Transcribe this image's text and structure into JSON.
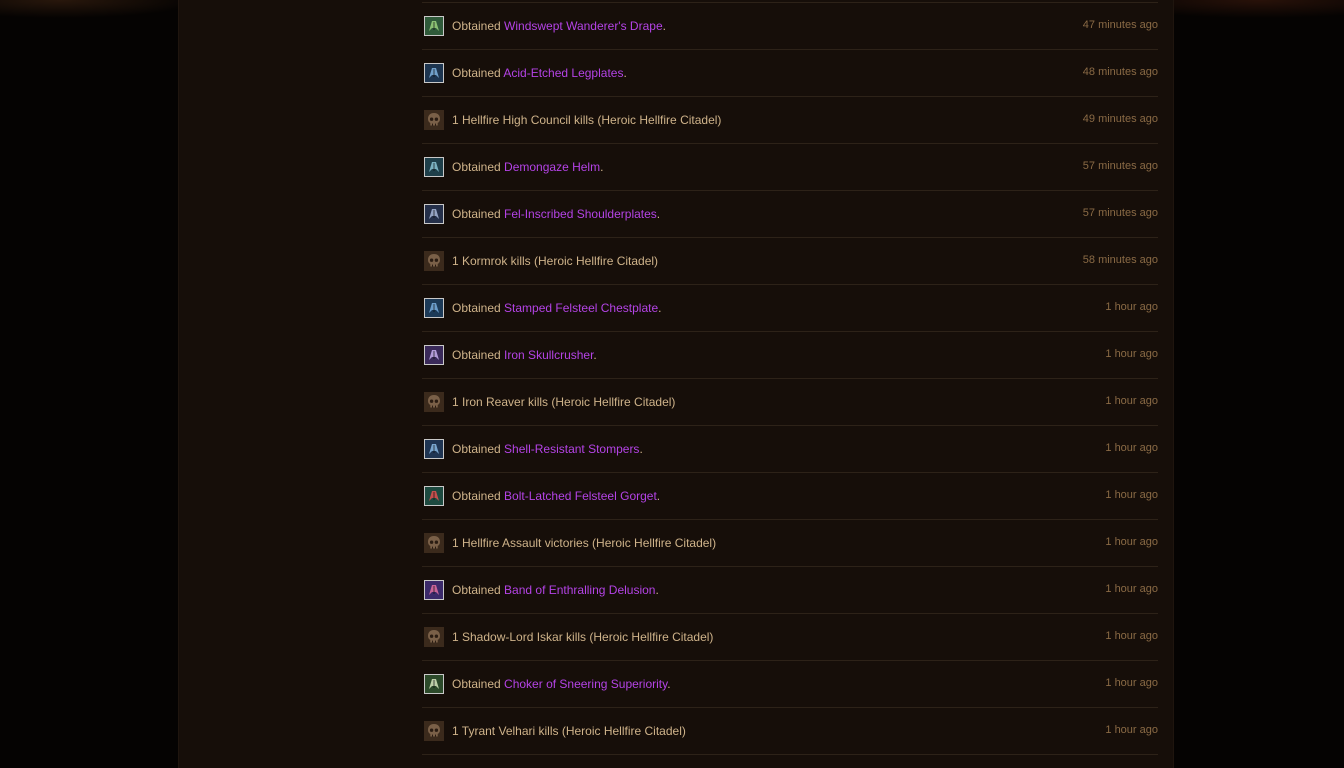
{
  "feed": {
    "items": [
      {
        "type": "loot",
        "prefix": "Obtained",
        "item": "Windswept Wanderer's Drape",
        "suffix": ".",
        "time": "47 minutes ago",
        "icon": "cloak-icon",
        "icon_bg": "#2f5a3a",
        "icon_fg": "#9ad27e"
      },
      {
        "type": "loot",
        "prefix": "Obtained",
        "item": "Acid-Etched Legplates",
        "suffix": ".",
        "time": "48 minutes ago",
        "icon": "legplates-icon",
        "icon_bg": "#1d3550",
        "icon_fg": "#7fb3e0"
      },
      {
        "type": "kill",
        "text": "1 Hellfire High Council kills (Heroic Hellfire Citadel)",
        "time": "49 minutes ago",
        "icon": "skull-icon"
      },
      {
        "type": "loot",
        "prefix": "Obtained",
        "item": "Demongaze Helm",
        "suffix": ".",
        "time": "57 minutes ago",
        "icon": "helm-icon",
        "icon_bg": "#1e3f4a",
        "icon_fg": "#8ac4d4"
      },
      {
        "type": "loot",
        "prefix": "Obtained",
        "item": "Fel-Inscribed Shoulderplates",
        "suffix": ".",
        "time": "57 minutes ago",
        "icon": "shoulderplates-icon",
        "icon_bg": "#25304a",
        "icon_fg": "#a9b8d8"
      },
      {
        "type": "kill",
        "text": "1 Kormrok kills (Heroic Hellfire Citadel)",
        "time": "58 minutes ago",
        "icon": "skull-icon"
      },
      {
        "type": "loot",
        "prefix": "Obtained",
        "item": "Stamped Felsteel Chestplate",
        "suffix": ".",
        "time": "1 hour ago",
        "icon": "chestplate-icon",
        "icon_bg": "#1c3a58",
        "icon_fg": "#78aede"
      },
      {
        "type": "loot",
        "prefix": "Obtained",
        "item": "Iron Skullcrusher",
        "suffix": ".",
        "time": "1 hour ago",
        "icon": "mace-icon",
        "icon_bg": "#3a2a5a",
        "icon_fg": "#c9b0f0"
      },
      {
        "type": "kill",
        "text": "1 Iron Reaver kills (Heroic Hellfire Citadel)",
        "time": "1 hour ago",
        "icon": "skull-icon"
      },
      {
        "type": "loot",
        "prefix": "Obtained",
        "item": "Shell-Resistant Stompers",
        "suffix": ".",
        "time": "1 hour ago",
        "icon": "boots-icon",
        "icon_bg": "#1f3553",
        "icon_fg": "#88b8e4"
      },
      {
        "type": "loot",
        "prefix": "Obtained",
        "item": "Bolt-Latched Felsteel Gorget",
        "suffix": ".",
        "time": "1 hour ago",
        "icon": "gorget-icon",
        "icon_bg": "#1d4a40",
        "icon_fg": "#e05050"
      },
      {
        "type": "kill",
        "text": "1 Hellfire Assault victories (Heroic Hellfire Citadel)",
        "time": "1 hour ago",
        "icon": "skull-icon"
      },
      {
        "type": "loot",
        "prefix": "Obtained",
        "item": "Band of Enthralling Delusion",
        "suffix": ".",
        "time": "1 hour ago",
        "icon": "ring-icon",
        "icon_bg": "#3b2a6a",
        "icon_fg": "#e070a0"
      },
      {
        "type": "kill",
        "text": "1 Shadow-Lord Iskar kills (Heroic Hellfire Citadel)",
        "time": "1 hour ago",
        "icon": "skull-icon"
      },
      {
        "type": "loot",
        "prefix": "Obtained",
        "item": "Choker of Sneering Superiority",
        "suffix": ".",
        "time": "1 hour ago",
        "icon": "necklace-icon",
        "icon_bg": "#2c4a2a",
        "icon_fg": "#d8e8c0"
      },
      {
        "type": "kill",
        "text": "1 Tyrant Velhari kills (Heroic Hellfire Citadel)",
        "time": "1 hour ago",
        "icon": "skull-icon"
      }
    ]
  },
  "colors": {
    "panel_bg": "#160e09",
    "page_bg": "#050302",
    "divider": "#2d2218",
    "text": "#cfb38a",
    "epic_item": "#b443e6",
    "timestamp": "#8a6a45"
  }
}
